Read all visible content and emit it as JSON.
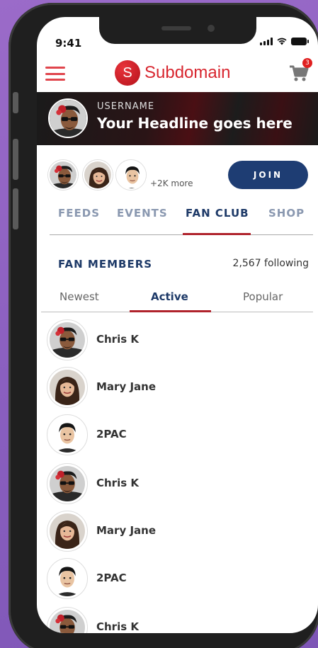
{
  "status_bar": {
    "time": "9:41"
  },
  "app": {
    "logo_letter": "S",
    "brand_name": "Subdomain",
    "cart_count": "3"
  },
  "hero": {
    "username": "USERNAME",
    "headline": "Your Headline goes here"
  },
  "members_preview": {
    "more_text": "+2K more",
    "join_label": "JOIN"
  },
  "tabs": [
    {
      "label": "FEEDS",
      "active": false
    },
    {
      "label": "EVENTS",
      "active": false
    },
    {
      "label": "FAN CLUB",
      "active": true
    },
    {
      "label": "SHOP",
      "active": false
    }
  ],
  "fan_members": {
    "title": "FAN MEMBERS",
    "following": "2,567 following"
  },
  "subtabs": [
    {
      "label": "Newest",
      "active": false
    },
    {
      "label": "Active",
      "active": true
    },
    {
      "label": "Popular",
      "active": false
    }
  ],
  "members": [
    {
      "name": "Chris K",
      "avatar": "man-sunglasses"
    },
    {
      "name": "Mary Jane",
      "avatar": "woman-dark-hair"
    },
    {
      "name": "2PAC",
      "avatar": "young-man"
    },
    {
      "name": "Chris K",
      "avatar": "man-sunglasses"
    },
    {
      "name": "Mary Jane",
      "avatar": "woman-dark-hair"
    },
    {
      "name": "2PAC",
      "avatar": "young-man"
    },
    {
      "name": "Chris K",
      "avatar": "man-sunglasses"
    }
  ],
  "colors": {
    "brand_red": "#d8262f",
    "navy": "#1e3d73",
    "accent_underline": "#b0232c",
    "background": "#8a5fbf"
  }
}
